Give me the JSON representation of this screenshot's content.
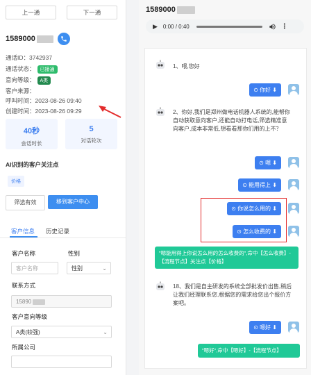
{
  "nav": {
    "prev": "上一通",
    "next": "下一通"
  },
  "customer": {
    "phone": "1589000",
    "call_id": "通话ID：3742937",
    "status_label": "通话状态：",
    "status_badge": "已接通",
    "intent_label": "意向等级：",
    "intent_badge": "A类",
    "source": "客户来源：",
    "call_time": "呼叫时间：2023-08-26 09:40",
    "create_time": "创建时间：2023-08-26 09:29"
  },
  "stats": [
    {
      "value": "40秒",
      "label": "会话时长"
    },
    {
      "value": "5",
      "label": "对话轮次"
    }
  ],
  "focus": {
    "title": "AI识别的客户关注点",
    "tag": "价格"
  },
  "actions": {
    "filter": "筛选有效",
    "move": "移到客户中心"
  },
  "tabs": {
    "info": "客户信息",
    "history": "历史记录"
  },
  "form": {
    "name_label": "客户名称",
    "name_placeholder": "客户名称",
    "gender_label": "性别",
    "gender_value": "性别",
    "contact_label": "联系方式",
    "contact_value": "15890",
    "intent_label": "客户意向等级",
    "intent_value": "A类(较强)",
    "company_label": "所属公司"
  },
  "player": {
    "phone": "1589000",
    "time": "0:00 / 0:40"
  },
  "chat": {
    "bot1": "1、喂,您好",
    "user1": "你好",
    "bot2": "2、你好,我们是郑州做电话机器人系统的,能帮你自动获取意向客户,还能自动打电话,筛选精准意向客户,成本非常低,想看看那你们用的上不？",
    "user2": "嗯",
    "user3": "能用得上",
    "user4": "你说怎么用的",
    "user5": "怎么收费的",
    "summary1": "\"嗯能用得上你说怎么用的怎么收费的\",命中【怎么收费】-【流程节点】关注点【价格】",
    "bot3": "18、我们是自主研发的系统全部批发价出售,稍后让我们经理联系您,根据您的需求给您出个报价方案吧。",
    "user6": "嗯好",
    "summary2": "\"嗯好\",命中【嗯好】-【流程节点】"
  }
}
